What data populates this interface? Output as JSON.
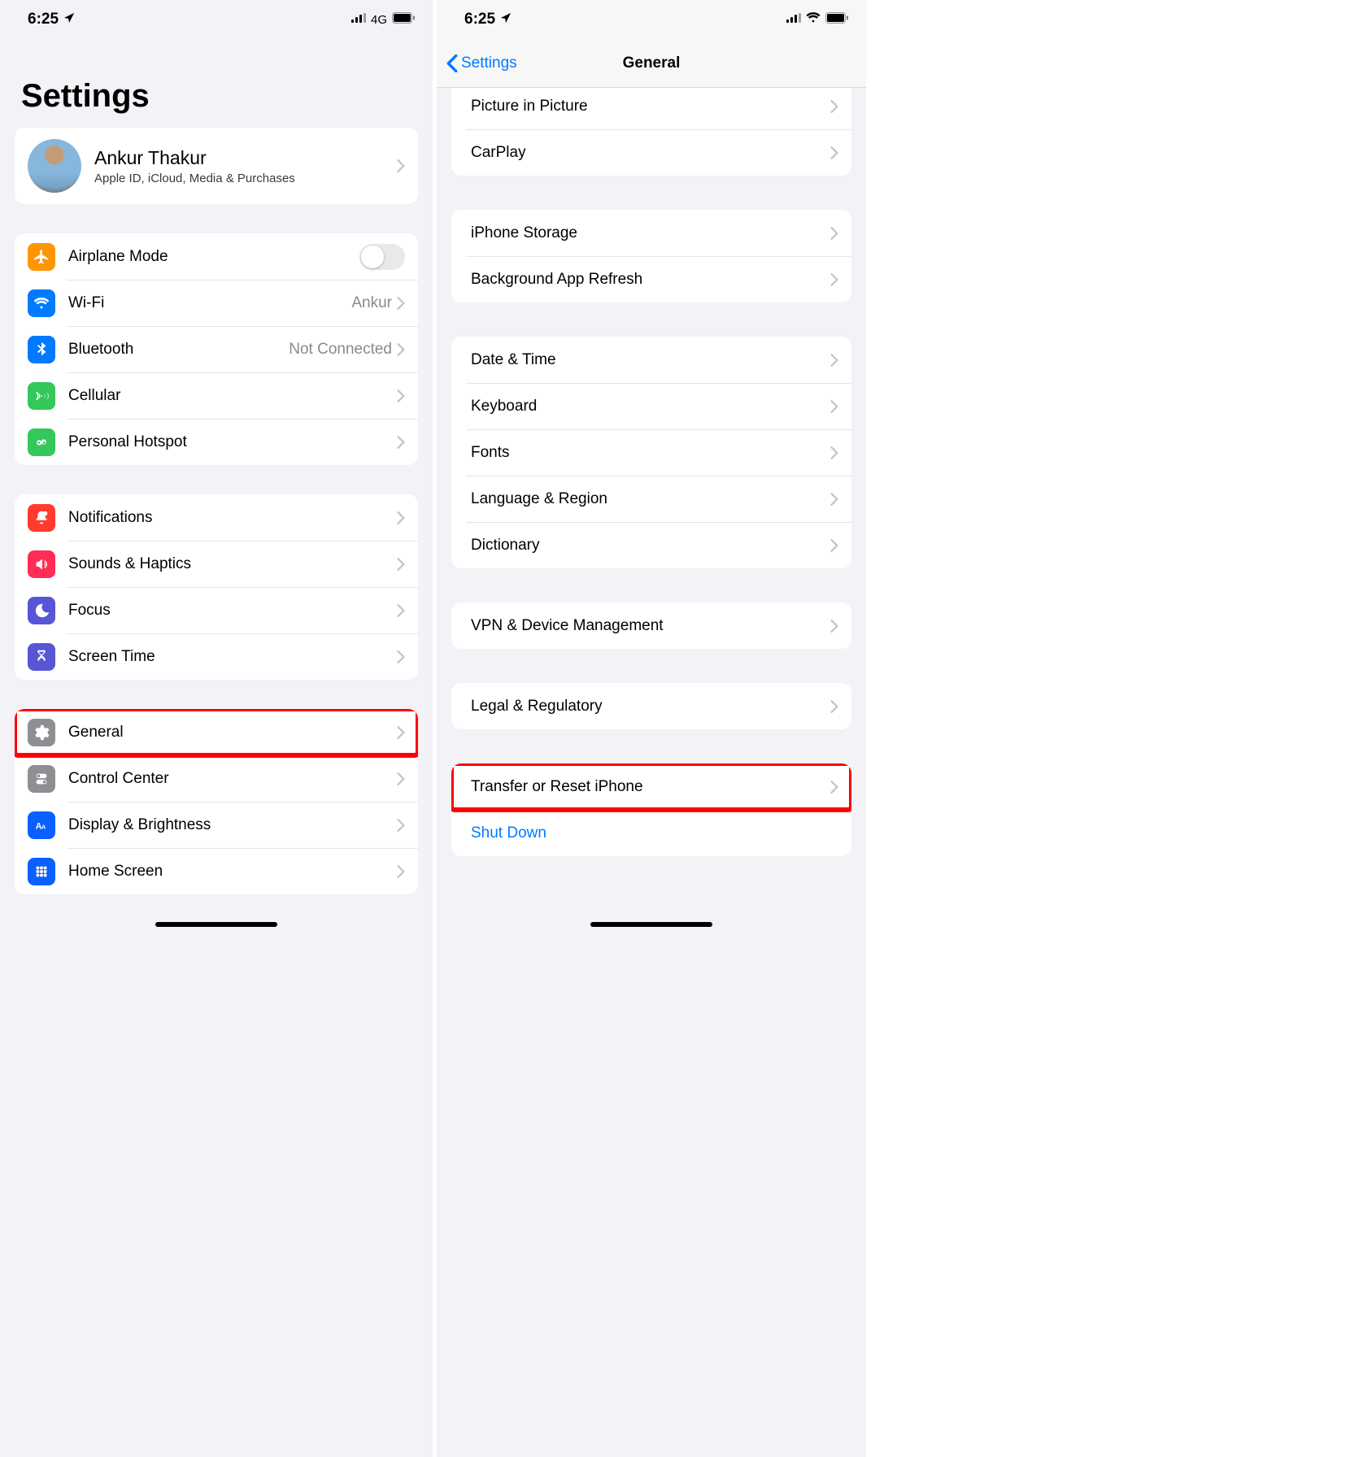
{
  "left": {
    "status": {
      "time": "6:25",
      "network": "4G"
    },
    "title": "Settings",
    "profile": {
      "name": "Ankur Thakur",
      "subtitle": "Apple ID, iCloud, Media & Purchases"
    },
    "group_radios": {
      "airplane": "Airplane Mode",
      "wifi": {
        "label": "Wi-Fi",
        "value": "Ankur"
      },
      "bluetooth": {
        "label": "Bluetooth",
        "value": "Not Connected"
      },
      "cellular": "Cellular",
      "hotspot": "Personal Hotspot"
    },
    "group_prefs": {
      "notifications": "Notifications",
      "sounds": "Sounds & Haptics",
      "focus": "Focus",
      "screentime": "Screen Time"
    },
    "group_sys": {
      "general": "General",
      "controlcenter": "Control Center",
      "display": "Display & Brightness",
      "home": "Home Screen"
    }
  },
  "right": {
    "status": {
      "time": "6:25"
    },
    "nav": {
      "back": "Settings",
      "title": "General"
    },
    "group_top": {
      "pip": "Picture in Picture",
      "carplay": "CarPlay"
    },
    "group_storage": {
      "storage": "iPhone Storage",
      "bg": "Background App Refresh"
    },
    "group_intl": {
      "datetime": "Date & Time",
      "keyboard": "Keyboard",
      "fonts": "Fonts",
      "lang": "Language & Region",
      "dict": "Dictionary"
    },
    "group_vpn": {
      "vpn": "VPN & Device Management"
    },
    "group_legal": {
      "legal": "Legal & Regulatory"
    },
    "group_reset": {
      "transfer": "Transfer or Reset iPhone",
      "shutdown": "Shut Down"
    }
  }
}
